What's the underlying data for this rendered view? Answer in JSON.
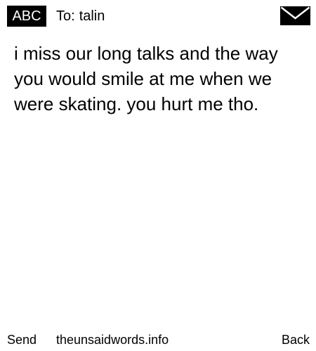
{
  "header": {
    "mode_label": "ABC",
    "to_label": "To:",
    "recipient": "talin",
    "icon": "envelope-icon"
  },
  "message": {
    "text": "i miss our long talks and the way you would smile at me when we were skating. you hurt me tho."
  },
  "footer": {
    "send_label": "Send",
    "site_label": "theunsaidwords.info",
    "back_label": "Back"
  }
}
